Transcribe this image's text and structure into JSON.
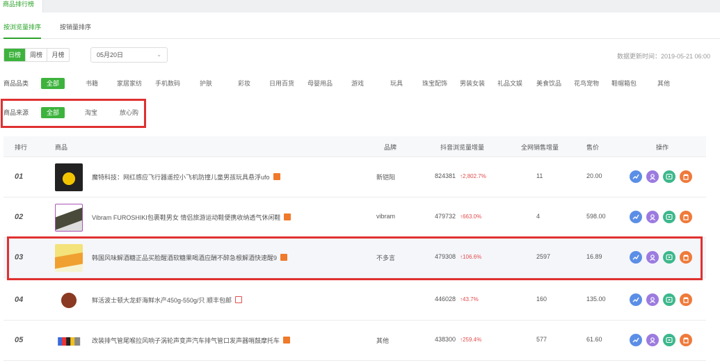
{
  "top_tab": "商品排行榜",
  "subtabs": [
    "按浏览量排序",
    "按销量排序"
  ],
  "period": [
    "日榜",
    "周榜",
    "月榜"
  ],
  "date": "05月20日",
  "updated": "数据更新时间：2019-05-21 06:00",
  "category": {
    "label": "商品品类",
    "items": [
      "全部",
      "书籍",
      "家居家纺",
      "手机数码",
      "护肤",
      "彩妆",
      "日用百货",
      "母婴用品",
      "游戏",
      "玩具",
      "珠宝配饰",
      "男装女装",
      "礼品文娱",
      "美食饮品",
      "花鸟宠物",
      "鞋帽箱包",
      "其他"
    ]
  },
  "source": {
    "label": "商品来源",
    "items": [
      "全部",
      "淘宝",
      "放心购"
    ]
  },
  "table": {
    "headers": [
      "排行",
      "商品",
      "品牌",
      "抖音浏览量增量",
      "全网销售增量",
      "售价",
      "操作"
    ],
    "rows": [
      {
        "rank": "01",
        "name": "魔特科技：网红感应飞行器遥控小飞机防撞儿童男孩玩具悬浮ufo",
        "brand": "新铠阳",
        "browse": "824381",
        "inc": "↑2,802.7%",
        "sales": "11",
        "price": "20.00"
      },
      {
        "rank": "02",
        "name": "Vibram FUROSHIKI包裹鞋男女 情侣旅游运动鞋便携收纳透气休闲鞋",
        "brand": "vibram",
        "browse": "479732",
        "inc": "↑663.0%",
        "sales": "4",
        "price": "598.00"
      },
      {
        "rank": "03",
        "name": "韩国风味解酒糖正品买脸醒酒软糖果喝酒应酬不醉急根解酒快速醒9",
        "brand": "不多言",
        "browse": "479308",
        "inc": "↑106.6%",
        "sales": "2597",
        "price": "16.89"
      },
      {
        "rank": "04",
        "name": "鲜活波士顿大龙虾海鲜水产450g-550g/只 顺丰包邮",
        "brand": "",
        "browse": "446028",
        "inc": "↑43.7%",
        "sales": "160",
        "price": "135.00"
      },
      {
        "rank": "05",
        "name": "改装排气管尾喉拉风响子涡轮声变声汽车排气管口发声器哨鼓摩托车",
        "brand": "其他",
        "browse": "438300",
        "inc": "↑259.4%",
        "sales": "577",
        "price": "61.60"
      }
    ]
  },
  "colors": {
    "accent": "#3db33d",
    "highlight_box": "#e03030"
  },
  "icons": [
    "trend-chart-icon",
    "user-icon",
    "play-icon",
    "shop-icon"
  ]
}
